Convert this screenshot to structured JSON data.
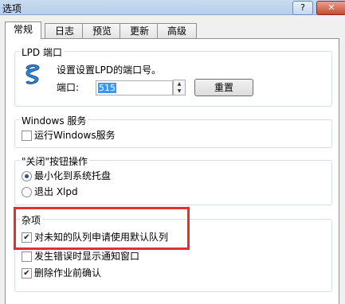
{
  "window": {
    "title": "选项",
    "help_label": "?",
    "close_label": "✕"
  },
  "tabs": [
    {
      "label": "常规"
    },
    {
      "label": "日志"
    },
    {
      "label": "预览"
    },
    {
      "label": "更新"
    },
    {
      "label": "高级"
    }
  ],
  "lpd": {
    "title": "LPD 端口",
    "description": "设置设置LPD的端口号。",
    "port_label": "端口:",
    "port_value": "515",
    "reset_label": "重置"
  },
  "windows_service": {
    "title": "Windows 服务",
    "run_label": "运行Windows服务",
    "run_checked": false
  },
  "close_action": {
    "title": "\"关闭\"按钮操作",
    "options": [
      {
        "label": "最小化到系统托盘",
        "selected": true
      },
      {
        "label": "退出 Xlpd",
        "selected": false
      }
    ]
  },
  "misc": {
    "title": "杂项",
    "items": [
      {
        "label": "对未知的队列申请使用默认队列",
        "checked": true
      },
      {
        "label": "发生错误时显示通知窗口",
        "checked": false
      },
      {
        "label": "删除作业前确认",
        "checked": true
      }
    ]
  },
  "colors": {
    "highlight": "#e0312f",
    "selection": "#3399ff"
  }
}
